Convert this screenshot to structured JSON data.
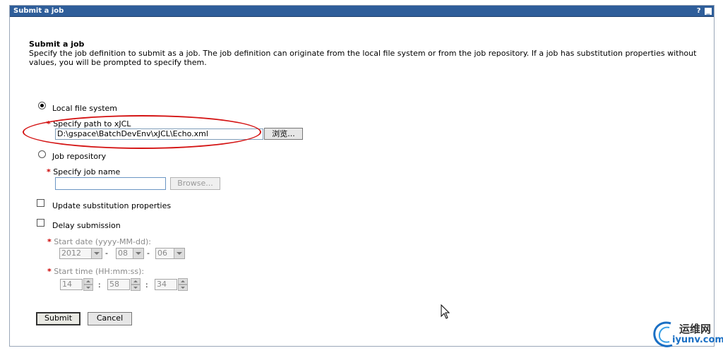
{
  "window": {
    "title": "Submit a job",
    "help_icon": "?",
    "minimize_icon": "_"
  },
  "page": {
    "heading": "Submit a job",
    "description": "Specify the job definition to submit as a job. The job definition can originate from the local file system or from the job repository. If a job has substitution properties without values, you will be prompted to specify them."
  },
  "source": {
    "local": {
      "label": "Local file system",
      "selected": true
    },
    "path_label": "Specify path to xJCL",
    "path_value": "D:\\gspace\\BatchDevEnv\\xJCL\\Echo.xml",
    "browse_local_label": "浏览...",
    "repository": {
      "label": "Job repository",
      "selected": false
    },
    "job_name_label": "Specify job name",
    "job_name_value": "",
    "browse_repo_label": "Browse..."
  },
  "options": {
    "update_substitution": {
      "label": "Update substitution properties",
      "checked": false
    },
    "delay_submission": {
      "label": "Delay submission",
      "checked": false
    }
  },
  "schedule": {
    "start_date_label": "Start date (yyyy-MM-dd):",
    "year": "2012",
    "month": "08",
    "day": "06",
    "date_sep": "-",
    "start_time_label": "Start time (HH:mm:ss):",
    "hour": "14",
    "minute": "58",
    "second": "34",
    "time_sep": ":"
  },
  "actions": {
    "submit_label": "Submit",
    "cancel_label": "Cancel"
  },
  "required_marker": "*",
  "watermark": {
    "cn": "运维网",
    "en": "iyunv.com"
  },
  "colors": {
    "title_bar": "#2f5e9a",
    "required": "#cc0000",
    "highlight_oval": "#d41414"
  }
}
